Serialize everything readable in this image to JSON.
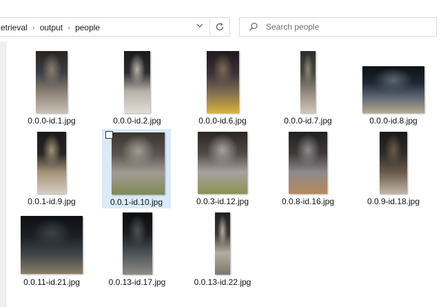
{
  "window": {
    "title": "people"
  },
  "address": {
    "crumbs": [
      "etrieval",
      "output",
      "people"
    ],
    "separator": "›",
    "dropdown_icon": "chevron-down-icon",
    "refresh_icon": "refresh-icon"
  },
  "search": {
    "placeholder": "Search people",
    "value": ""
  },
  "files": [
    {
      "name": "0.0.0-id.1.jpg",
      "selected": false,
      "colors": [
        "#3a3f44",
        "#8a7f72",
        "#c9c2b4",
        "#2b2420"
      ]
    },
    {
      "name": "0.0.0-id.2.jpg",
      "selected": false,
      "colors": [
        "#2c2d31",
        "#b7b2a8",
        "#e0ddd6",
        "#1b1b1d"
      ]
    },
    {
      "name": "0.0.0-id.6.jpg",
      "selected": false,
      "colors": [
        "#3b3036",
        "#7c6a52",
        "#d7b33c",
        "#21191c"
      ]
    },
    {
      "name": "0.0.0-id.7.jpg",
      "selected": false,
      "colors": [
        "#4a4a44",
        "#8e877a",
        "#cfc8bb",
        "#2d2b27"
      ]
    },
    {
      "name": "0.0.0-id.8.jpg",
      "selected": false,
      "colors": [
        "#1f2630",
        "#5b6674",
        "#b4a98d",
        "#0f1216"
      ]
    },
    {
      "name": "0.0.1-id.9.jpg",
      "selected": false,
      "colors": [
        "#262626",
        "#a49277",
        "#d5cfc5",
        "#1a1a1a"
      ]
    },
    {
      "name": "0.0.1-id.10.jpg",
      "selected": true,
      "colors": [
        "#5a5550",
        "#a19c93",
        "#7e8a56",
        "#3a3330"
      ]
    },
    {
      "name": "0.0.3-id.12.jpg",
      "selected": false,
      "colors": [
        "#4f4b48",
        "#a7a2a0",
        "#8b9450",
        "#2b2623"
      ]
    },
    {
      "name": "0.0.8-id.16.jpg",
      "selected": false,
      "colors": [
        "#3e3a39",
        "#8c8a8c",
        "#b58a5a",
        "#222022"
      ]
    },
    {
      "name": "0.0.9-id.18.jpg",
      "selected": false,
      "colors": [
        "#2e2b2a",
        "#6a5a4a",
        "#c0b6a5",
        "#1c1a19"
      ]
    },
    {
      "name": "0.0.11-id.21.jpg",
      "selected": false,
      "colors": [
        "#1d2024",
        "#3c4348",
        "#8a7f66",
        "#0d0f11"
      ]
    },
    {
      "name": "0.0.13-id.17.jpg",
      "selected": false,
      "colors": [
        "#1c1d1f",
        "#4c5156",
        "#8d8c85",
        "#0c0c0d"
      ]
    },
    {
      "name": "0.0.13-id.22.jpg",
      "selected": false,
      "colors": [
        "#3c3a38",
        "#b3ada2",
        "#7d7669",
        "#23211f"
      ]
    }
  ]
}
